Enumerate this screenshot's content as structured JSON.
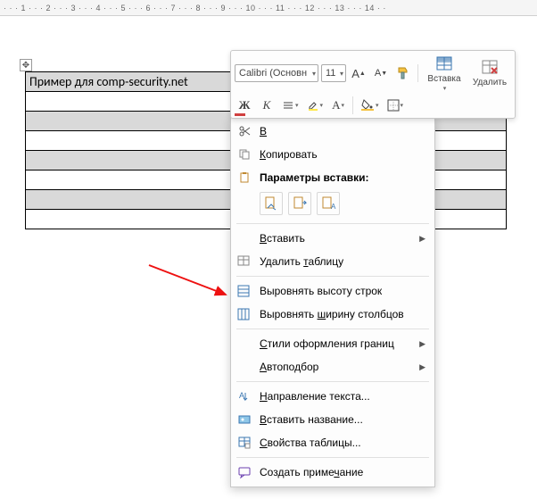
{
  "ruler_text": "· · · 1 · · · 2 · · · 3 · · · 4 · · · 5 · · · 6 · · · 7 · · · 8 · · · 9 · · · 10 · · · 11 · · · 12 · · · 13 · · · 14 · ·",
  "table": {
    "cell_text": "Пример для comp-security.net"
  },
  "mini_toolbar": {
    "font_name": "Calibri (Основн",
    "font_size": "11",
    "grow_font": "A",
    "shrink_font": "A",
    "bold": "Ж",
    "italic": "К",
    "insert_label": "Вставка",
    "delete_label": "Удалить"
  },
  "context_menu": {
    "cut": "Вырезать",
    "copy": "Копировать",
    "paste_options": "Параметры вставки:",
    "insert": "Вставить",
    "delete_table": "Удалить таблицу",
    "distribute_rows": "Выровнять высоту строк",
    "distribute_cols": "Выровнять ширину столбцов",
    "border_styles": "Стили оформления границ",
    "autofit": "Автоподбор",
    "text_direction": "Направление текста...",
    "insert_caption": "Вставить название...",
    "table_properties": "Свойства таблицы...",
    "new_comment": "Создать примечание"
  }
}
